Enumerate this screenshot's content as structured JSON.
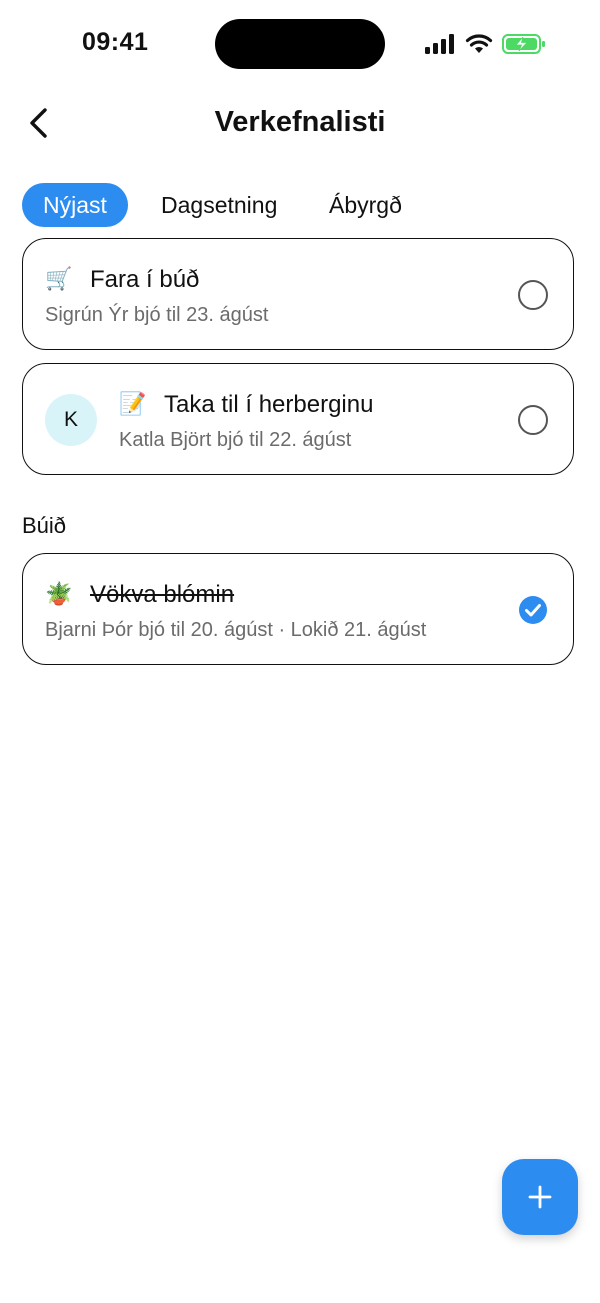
{
  "status_bar": {
    "time": "09:41",
    "icons": [
      "signal-icon",
      "wifi-icon",
      "battery-charging-icon"
    ]
  },
  "header": {
    "title": "Verkefnalisti",
    "back_icon": "chevron-left-icon"
  },
  "tabs": [
    {
      "label": "Nýjast",
      "active": true
    },
    {
      "label": "Dagsetning",
      "active": false
    },
    {
      "label": "Ábyrgð",
      "active": false
    }
  ],
  "tasks": [
    {
      "emoji": "🛒",
      "title": "Fara í búð",
      "subtitle": "Sigrún Ýr bjó til 23. ágúst",
      "done": false
    },
    {
      "avatar": "K",
      "emoji": "📝",
      "title": "Taka til í herberginu",
      "subtitle": "Katla Björt bjó til 22. ágúst",
      "done": false
    }
  ],
  "done_section": {
    "heading": "Búið",
    "tasks": [
      {
        "emoji": "🪴",
        "title": "Vökva blómin",
        "subtitle": "Bjarni Þór bjó til 20. ágúst · Lokið 21. ágúst",
        "done": true
      }
    ]
  },
  "fab": {
    "icon": "plus-icon"
  },
  "colors": {
    "accent": "#2d8cf0",
    "avatar_bg": "#d9f4f8",
    "subtitle_text": "#6b6b6b",
    "battery_green": "#4cd964"
  }
}
